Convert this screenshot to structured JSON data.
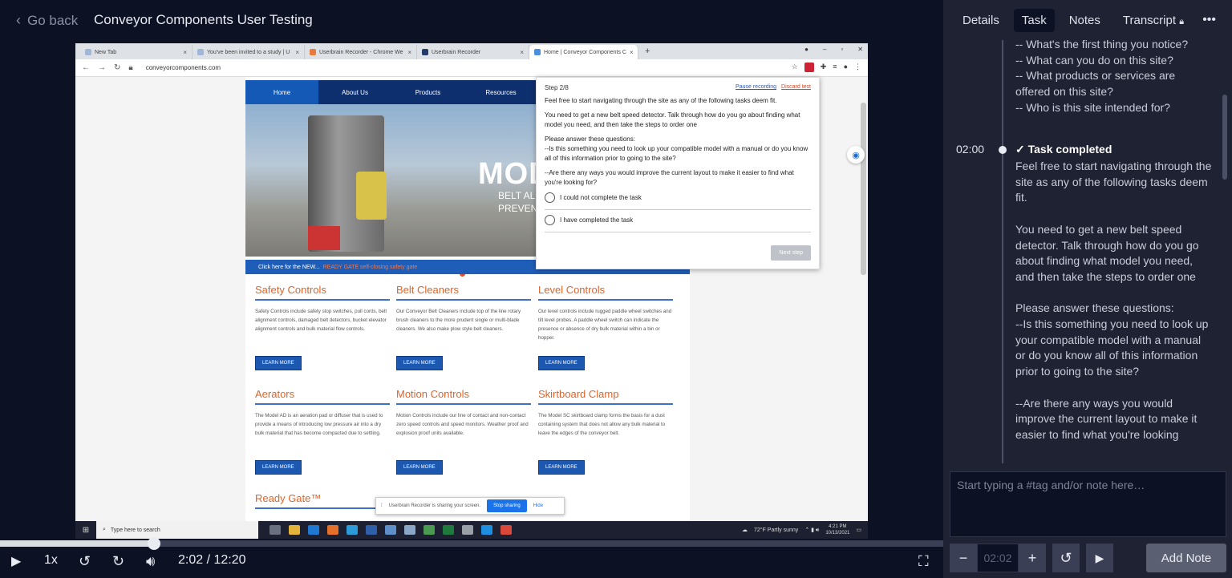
{
  "header": {
    "back_label": "Go back",
    "title": "Conveyor Components User Testing"
  },
  "browser": {
    "tabs": [
      {
        "label": "New Tab"
      },
      {
        "label": "You've been invited to a study | U"
      },
      {
        "label": "Userbrain Recorder - Chrome We"
      },
      {
        "label": "Userbrain Recorder"
      },
      {
        "label": "Home | Conveyor Components C"
      }
    ],
    "url": "conveyorcomponents.com"
  },
  "site": {
    "nav": [
      "Home",
      "About Us",
      "Products",
      "Resources"
    ],
    "hero_big": "MOD",
    "hero_sub1": "BELT AL",
    "hero_sub2": "PREVEN",
    "strip_text": "Click here for the NEW...",
    "strip_highlight": "READY GATE self-closing safety gate",
    "cards": [
      {
        "title": "Safety Controls",
        "text": "Safety Controls include safety stop switches, pull cords, belt alignment controls, damaged belt detectors, bucket elevator alignment controls and bulk material flow controls.",
        "button": "LEARN MORE"
      },
      {
        "title": "Belt Cleaners",
        "text": "Our Conveyor Belt Cleaners include top of the line rotary brush cleaners to the more prudent single or multi-blade cleaners. We also make plow style belt cleaners.",
        "button": "LEARN MORE"
      },
      {
        "title": "Level Controls",
        "text": "Our level controls include rugged paddle wheel switches and tilt level probes. A paddle wheel switch can indicate the presence or absence of dry bulk material within a bin or hopper.",
        "button": "LEARN MORE"
      },
      {
        "title": "Aerators",
        "text": "The Model AD is an aeration pad or diffuser that is used to provide a means of introducing low pressure air into a dry bulk material that has become compacted due to settling.",
        "button": "LEARN MORE"
      },
      {
        "title": "Motion Controls",
        "text": "Motion Controls include our line of contact and non-contact zero speed controls and speed monitors. Weather proof and explosion proof units available.",
        "button": "LEARN MORE"
      },
      {
        "title": "Skirtboard Clamp",
        "text": "The Model SC skirtboard clamp forms the basis for a dust containing system that does not allow any bulk material to leave the edges of the conveyor belt.",
        "button": "LEARN MORE"
      }
    ],
    "next_heading": "Ready Gate™",
    "share_text": "Userbrain Recorder is sharing your screen.",
    "share_stop": "Stop sharing",
    "share_hide": "Hide"
  },
  "popup": {
    "step": "Step 2/8",
    "pause": "Pause recording",
    "discard": "Discard test",
    "p1": "Feel free to start navigating through the site as any of the following tasks deem fit.",
    "p2": "You need to get a new belt speed detector. Talk through how do you go about finding what model you need, and then take the steps to order one",
    "p3": "Please answer these questions:\n--Is this something you need to look up your compatible model with a manual or do you know all of this information prior to going to the site?",
    "p4": "--Are there any ways you would improve the current layout to make it easier to find what you're looking for?",
    "opt1": "I could not complete the task",
    "opt2": "I have completed the task",
    "next": "Next step"
  },
  "taskbar": {
    "search": "Type here to search",
    "weather": "72°F  Partly sunny",
    "time": "4:21 PM",
    "date": "10/13/2021"
  },
  "player": {
    "speed": "1x",
    "time": "2:02 / 12:20",
    "progress_fraction": 0.163
  },
  "panel": {
    "tabs": [
      "Details",
      "Task",
      "Notes",
      "Transcript"
    ],
    "active_tab": "Task",
    "prev_text": "-- What's the first thing you notice?\n-- What can you do on this site?\n-- What products or services are offered on this site?\n-- Who is this site intended for?",
    "timestamp": "02:00",
    "completed_label": "Task completed",
    "task_text": "Feel free to start navigating through the site as any of the following tasks deem fit.\n\nYou need to get a new belt speed detector. Talk through how do you go about finding what model you need, and then take the steps to order one\n\nPlease answer these questions:\n--Is this something you need to look up your compatible model with a manual or do you know all of this information prior to going to the site?\n\n--Are there any ways you would improve the current layout to make it easier to find what you're looking",
    "note_placeholder": "Start typing a #tag and/or note here…",
    "note_time": "02:02",
    "add_note": "Add Note"
  }
}
